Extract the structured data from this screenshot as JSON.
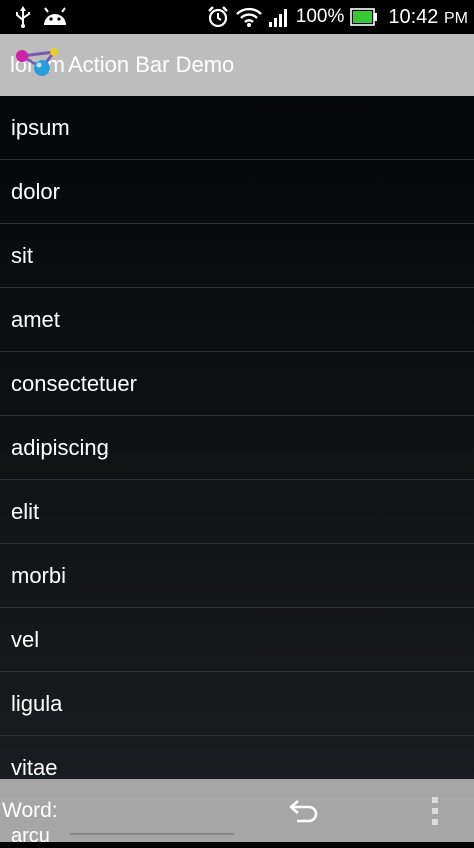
{
  "status_bar": {
    "battery_percent": "100%",
    "time": "10:42",
    "am_pm": "PM",
    "icons": [
      "usb-icon",
      "android-debug-icon",
      "alarm-icon",
      "wifi-icon",
      "signal-icon",
      "battery-icon"
    ],
    "battery_color": "#37c837"
  },
  "action_bar": {
    "title": "Action Bar Demo",
    "overlapped_text": "lorem",
    "background": "#bdbdbd"
  },
  "list": {
    "items": [
      "ipsum",
      "dolor",
      "sit",
      "amet",
      "consectetuer",
      "adipiscing",
      "elit",
      "morbi",
      "vel",
      "ligula",
      "vitae",
      "arcu"
    ]
  },
  "bottom_bar": {
    "word_label": "Word:",
    "word_value": "",
    "undo_icon": "undo-icon",
    "overflow_icon": "overflow-menu-icon"
  }
}
